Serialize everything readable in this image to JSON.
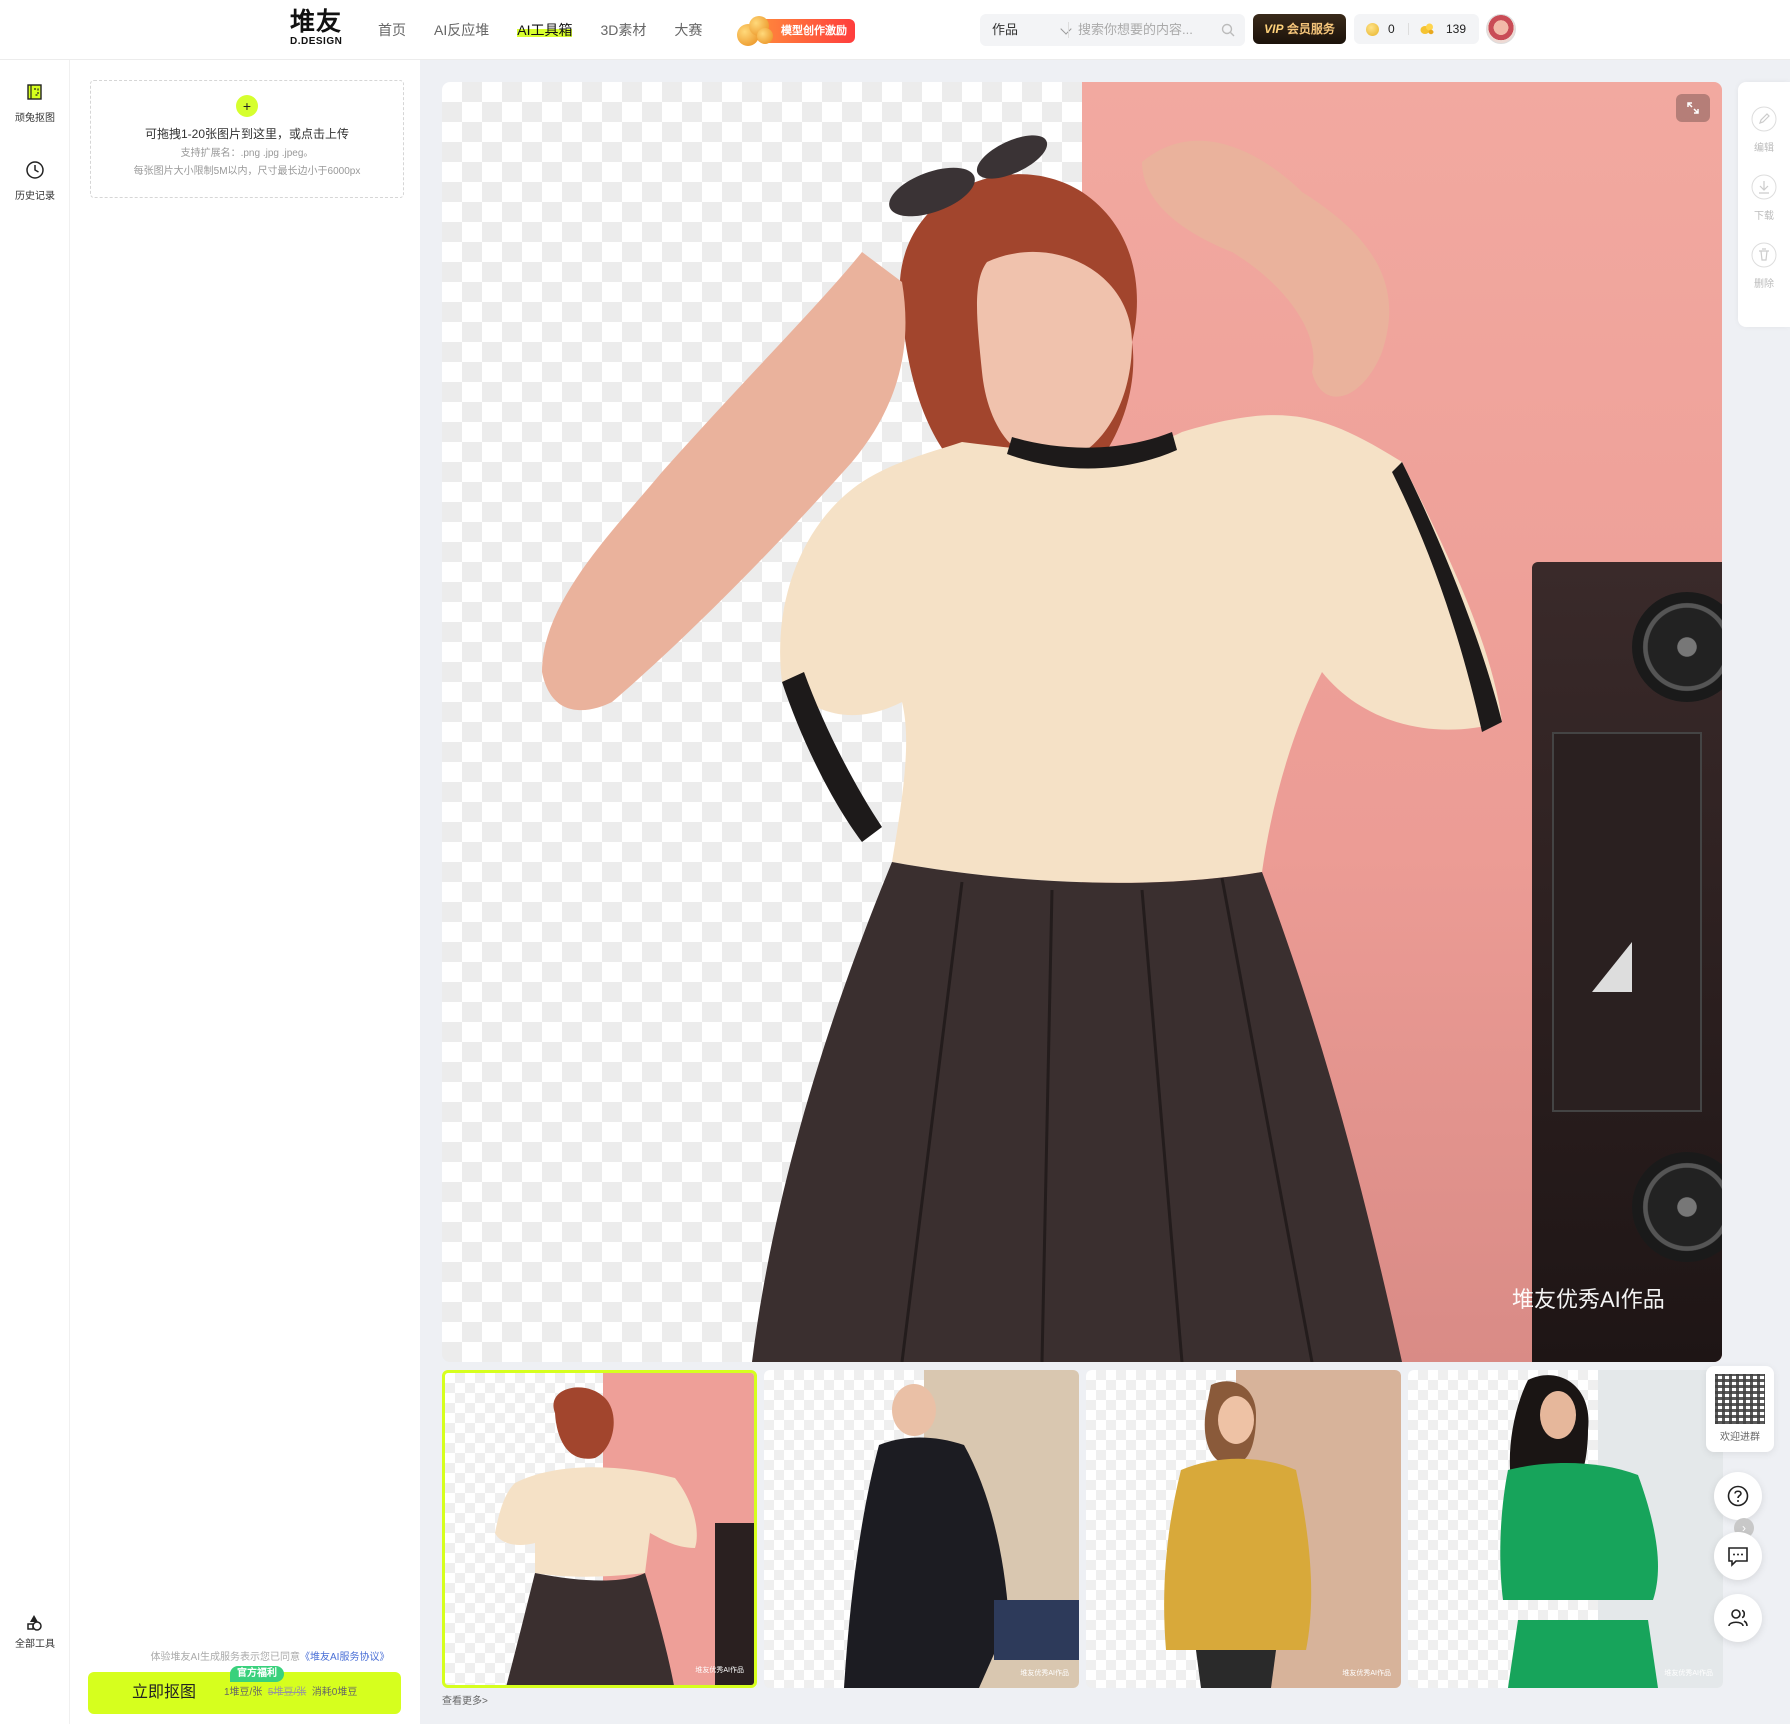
{
  "header": {
    "logo_main": "堆友",
    "logo_sub": "D.DESIGN",
    "nav": [
      "首页",
      "AI反应堆",
      "AI工具箱",
      "3D素材",
      "大赛"
    ],
    "nav_active_index": 2,
    "promo_label": "模型创作激励",
    "search": {
      "category": "作品",
      "placeholder": "搜索你想要的内容..."
    },
    "vip_label": "会员服务",
    "vip_prefix": "VIP",
    "coins": "0",
    "beans": "139",
    "accent_color": "#d6ff1e"
  },
  "rail": {
    "items": [
      {
        "label": "顽兔抠图",
        "icon": "cutout-icon"
      },
      {
        "label": "历史记录",
        "icon": "clock-icon"
      }
    ],
    "bottom": {
      "label": "全部工具",
      "icon": "tools-icon"
    }
  },
  "panel": {
    "upload_title": "可拖拽1-20张图片到这里，或点击上传",
    "upload_formats": "支持扩展名：.png .jpg .jpeg。",
    "upload_limits": "每张图片大小限制5M以内，尺寸最长边小于6000px",
    "agreement_prefix": "体验堆友AI生成服务表示您已同意",
    "agreement_link": "《堆友AI服务协议》",
    "cta_label": "立即抠图",
    "cta_badge": "官方福利",
    "cta_price": "1堆豆/张",
    "cta_old_price": "5堆豆/张",
    "cta_cost": "消耗0堆豆"
  },
  "preview": {
    "watermark": "堆友优秀AI作品"
  },
  "right_tools": [
    {
      "label": "编辑",
      "icon": "edit-icon"
    },
    {
      "label": "下载",
      "icon": "download-icon"
    },
    {
      "label": "删除",
      "icon": "trash-icon"
    }
  ],
  "thumbnails": [
    {
      "name": "pink-knit-top",
      "selected": true,
      "watermark": "堆友优秀AI作品"
    },
    {
      "name": "black-plaid-dress",
      "selected": false,
      "watermark": "堆友优秀AI作品"
    },
    {
      "name": "mustard-blazer",
      "selected": false,
      "watermark": "堆友优秀AI作品"
    },
    {
      "name": "green-suit",
      "selected": false,
      "watermark": "堆友优秀AI作品"
    }
  ],
  "more_link": "查看更多>",
  "side": {
    "qr_label": "欢迎进群"
  }
}
